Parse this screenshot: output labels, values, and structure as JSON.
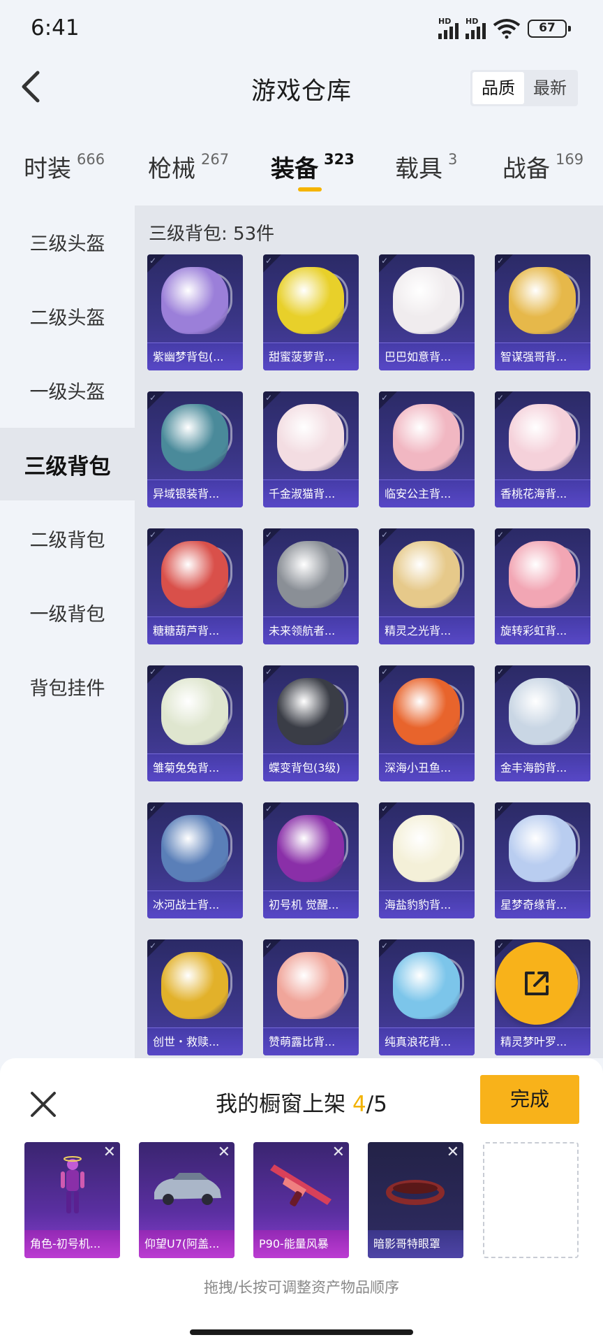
{
  "status": {
    "time": "6:41",
    "battery": "67",
    "hd1": "HD",
    "hd2": "HD"
  },
  "header": {
    "title": "游戏仓库",
    "sort_options": [
      "品质",
      "最新"
    ],
    "sort_active": "品质"
  },
  "tabs": [
    {
      "label": "时装",
      "count": "666"
    },
    {
      "label": "枪械",
      "count": "267"
    },
    {
      "label": "装备",
      "count": "323"
    },
    {
      "label": "载具",
      "count": "3"
    },
    {
      "label": "战备",
      "count": "169"
    }
  ],
  "active_tab": "装备",
  "sidebar": {
    "items": [
      "三级头盔",
      "二级头盔",
      "一级头盔",
      "三级背包",
      "二级背包",
      "一级背包",
      "背包挂件"
    ],
    "active": "三级背包"
  },
  "content": {
    "header": "三级背包: 53件",
    "items": [
      {
        "name": "紫幽梦背包(...",
        "color": "#9b7fd9"
      },
      {
        "name": "甜蜜菠萝背...",
        "color": "#e8d02a"
      },
      {
        "name": "巴巴如意背...",
        "color": "#f0ecee"
      },
      {
        "name": "智谋强哥背...",
        "color": "#e6b84a"
      },
      {
        "name": "异域银装背...",
        "color": "#4a8a9a"
      },
      {
        "name": "千金淑猫背...",
        "color": "#f3dde2"
      },
      {
        "name": "临安公主背...",
        "color": "#f1b7c2"
      },
      {
        "name": "香桃花海背...",
        "color": "#f5d1da"
      },
      {
        "name": "糖糖葫芦背...",
        "color": "#d9504a"
      },
      {
        "name": "未来领航者...",
        "color": "#8a8f96"
      },
      {
        "name": "精灵之光背...",
        "color": "#e6c98a"
      },
      {
        "name": "旋转彩虹背...",
        "color": "#f2a6b4"
      },
      {
        "name": "雏菊兔兔背...",
        "color": "#dfe6cf"
      },
      {
        "name": "蝶变背包(3级)",
        "color": "#3a3d46"
      },
      {
        "name": "深海小丑鱼...",
        "color": "#e8642c"
      },
      {
        "name": "金丰海韵背...",
        "color": "#c9d6e4"
      },
      {
        "name": "冰河战士背...",
        "color": "#5a7fb8"
      },
      {
        "name": "初号机 觉醒...",
        "color": "#8a2fa8"
      },
      {
        "name": "海盐豹豹背...",
        "color": "#f4f0d8"
      },
      {
        "name": "星梦奇缘背...",
        "color": "#b9cdf0"
      },
      {
        "name": "创世・救赎...",
        "color": "#e2b12a"
      },
      {
        "name": "赞萌露比背...",
        "color": "#f0a59a"
      },
      {
        "name": "纯真浪花背...",
        "color": "#7cc5ea"
      },
      {
        "name": "精灵梦叶罗...",
        "color": "#c5d890"
      }
    ]
  },
  "showcase": {
    "title_prefix": "我的橱窗上架",
    "current": "4",
    "total": "/5",
    "done_label": "完成",
    "slots": [
      {
        "name": "角色-初号机...",
        "color": "#8a3ed0"
      },
      {
        "name": "仰望U7(阿盖...",
        "color": "#aab6c8"
      },
      {
        "name": "P90-能量风暴",
        "color": "#d8405a"
      },
      {
        "name": "暗影哥特眼罩",
        "color": "#8a2a2a"
      }
    ],
    "hint": "拖拽/长按可调整资产物品顺序"
  }
}
